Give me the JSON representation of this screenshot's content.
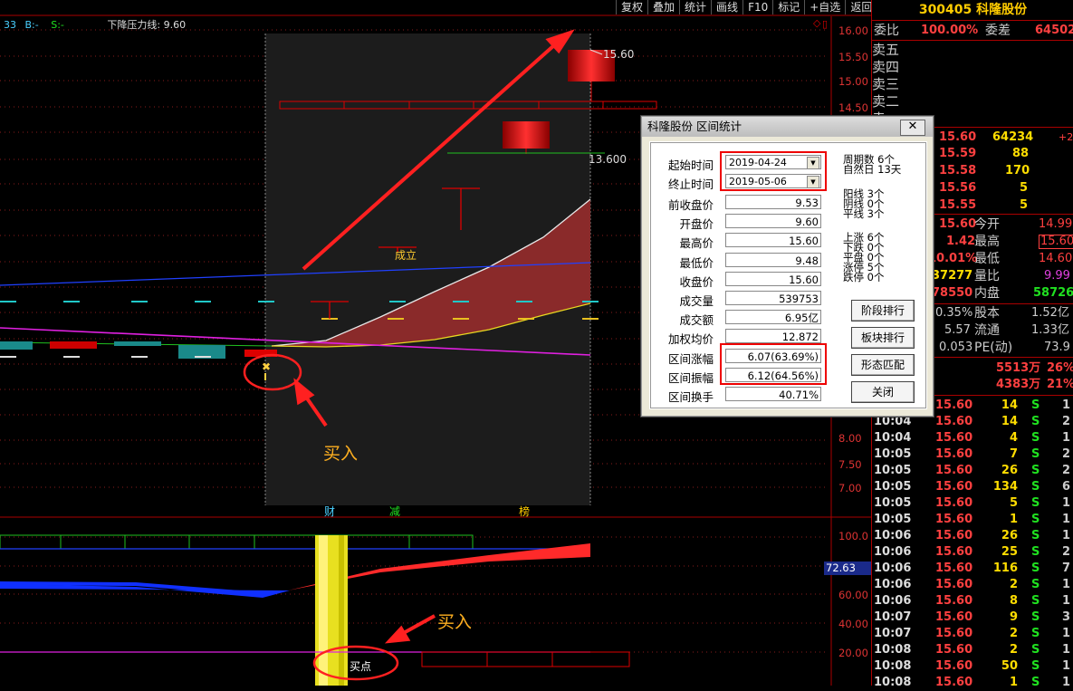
{
  "toolbar": {
    "items": [
      "复权",
      "叠加",
      "统计",
      "画线",
      "F10",
      "标记",
      "+自选",
      "返回"
    ]
  },
  "legend": {
    "ma1": "33",
    "b_label": "B:-",
    "s_label": "S:-",
    "resistance_label": "下降压力线: 9.60"
  },
  "price_axis": {
    "labels": [
      "16.00",
      "15.50",
      "15.00",
      "14.50",
      "8.00",
      "7.50",
      "7.00"
    ]
  },
  "indicator_axis": {
    "labels": [
      "100.0",
      "72.63",
      "60.00",
      "40.00",
      "20.00"
    ]
  },
  "chart_annotations": {
    "high_label": "15.60",
    "mid_label": "13.600",
    "chengli": "成立",
    "buy_text_upper": "买入",
    "buy_text_lower": "买入",
    "buy_point": "买点",
    "event_cai": "财",
    "event_jian": "减",
    "event_bang": "榜"
  },
  "stock": {
    "code": "300405",
    "name": "科隆股份"
  },
  "right_panel": {
    "weibi_label": "委比",
    "weibi_value": "100.00%",
    "weicha_label": "委差",
    "weicha_value": "64502",
    "sell_levels": [
      "卖五",
      "卖四",
      "卖三",
      "卖二",
      "卖一"
    ],
    "buy_levels": [
      {
        "price": "15.60",
        "vol": "64234",
        "chg": "+2"
      },
      {
        "price": "15.59",
        "vol": "88",
        "chg": ""
      },
      {
        "price": "15.58",
        "vol": "170",
        "chg": ""
      },
      {
        "price": "15.56",
        "vol": "5",
        "chg": ""
      },
      {
        "price": "15.55",
        "vol": "5",
        "chg": ""
      }
    ],
    "quotes": [
      {
        "v": "15.60",
        "k": "今开",
        "k_v": "14.99"
      },
      {
        "v": "1.42",
        "k": "最高",
        "k_v": "15.60"
      },
      {
        "v": "10.01%",
        "k": "最低",
        "k_v": "14.60"
      },
      {
        "v": "37277",
        "k": "量比",
        "k_v": "9.99"
      },
      {
        "v": "78550",
        "k": "内盘",
        "k_v": "58726"
      }
    ],
    "stats": [
      {
        "v": "0.35%",
        "k": "股本",
        "k_v": "1.52亿"
      },
      {
        "v": "5.57",
        "k": "流通",
        "k_v": "1.33亿"
      },
      {
        "v": "0.053",
        "k": "PE(动)",
        "k_v": "73.9"
      }
    ],
    "flows": [
      {
        "a": "5513万",
        "b": "26%"
      },
      {
        "a": "4383万",
        "b": "21%"
      }
    ],
    "ticks": [
      {
        "t": "",
        "p": "15.60",
        "v": "14",
        "s": "S",
        "n": "1"
      },
      {
        "t": "10:04",
        "p": "15.60",
        "v": "14",
        "s": "S",
        "n": "2"
      },
      {
        "t": "10:04",
        "p": "15.60",
        "v": "4",
        "s": "S",
        "n": "1"
      },
      {
        "t": "10:05",
        "p": "15.60",
        "v": "7",
        "s": "S",
        "n": "2"
      },
      {
        "t": "10:05",
        "p": "15.60",
        "v": "26",
        "s": "S",
        "n": "2"
      },
      {
        "t": "10:05",
        "p": "15.60",
        "v": "134",
        "s": "S",
        "n": "6"
      },
      {
        "t": "10:05",
        "p": "15.60",
        "v": "5",
        "s": "S",
        "n": "1"
      },
      {
        "t": "10:05",
        "p": "15.60",
        "v": "1",
        "s": "S",
        "n": "1"
      },
      {
        "t": "10:06",
        "p": "15.60",
        "v": "26",
        "s": "S",
        "n": "1"
      },
      {
        "t": "10:06",
        "p": "15.60",
        "v": "25",
        "s": "S",
        "n": "2"
      },
      {
        "t": "10:06",
        "p": "15.60",
        "v": "116",
        "s": "S",
        "n": "7"
      },
      {
        "t": "10:06",
        "p": "15.60",
        "v": "2",
        "s": "S",
        "n": "1"
      },
      {
        "t": "10:06",
        "p": "15.60",
        "v": "8",
        "s": "S",
        "n": "1"
      },
      {
        "t": "10:07",
        "p": "15.60",
        "v": "9",
        "s": "S",
        "n": "3"
      },
      {
        "t": "10:07",
        "p": "15.60",
        "v": "2",
        "s": "S",
        "n": "1"
      },
      {
        "t": "10:08",
        "p": "15.60",
        "v": "2",
        "s": "S",
        "n": "1"
      },
      {
        "t": "10:08",
        "p": "15.60",
        "v": "50",
        "s": "S",
        "n": "1"
      },
      {
        "t": "10:08",
        "p": "15.60",
        "v": "1",
        "s": "S",
        "n": "1"
      }
    ]
  },
  "dialog": {
    "title": "科隆股份 区间统计",
    "close": "✕",
    "start_label": "起始时间",
    "start_value": "2019-04-24",
    "end_label": "终止时间",
    "end_value": "2019-05-06",
    "fields": [
      {
        "label": "前收盘价",
        "value": "9.53"
      },
      {
        "label": "开盘价",
        "value": "9.60"
      },
      {
        "label": "最高价",
        "value": "15.60"
      },
      {
        "label": "最低价",
        "value": "9.48"
      },
      {
        "label": "收盘价",
        "value": "15.60"
      },
      {
        "label": "成交量",
        "value": "539753"
      },
      {
        "label": "成交额",
        "value": "6.95亿"
      },
      {
        "label": "加权均价",
        "value": "12.872"
      },
      {
        "label": "区间涨幅",
        "value": "6.07(63.69%)"
      },
      {
        "label": "区间振幅",
        "value": "6.12(64.56%)"
      },
      {
        "label": "区间换手",
        "value": "40.71%"
      }
    ],
    "info_period": "周期数 6个",
    "info_natural": "自然日 13天",
    "info_yang": "阳线 3个",
    "info_yin": "阴线 0个",
    "info_ping": "平线 3个",
    "info_up": "上涨 6个",
    "info_down": "下跌 0个",
    "info_flat": "平盘 0个",
    "info_limitup": "涨停 5个",
    "info_limitdown": "跌停 0个",
    "buttons": [
      "阶段排行",
      "板块排行",
      "形态匹配",
      "关闭"
    ]
  },
  "colors": {
    "accent_red": "#ff2020",
    "yellow": "#ffcc00",
    "buy_text": "#ffb020"
  }
}
